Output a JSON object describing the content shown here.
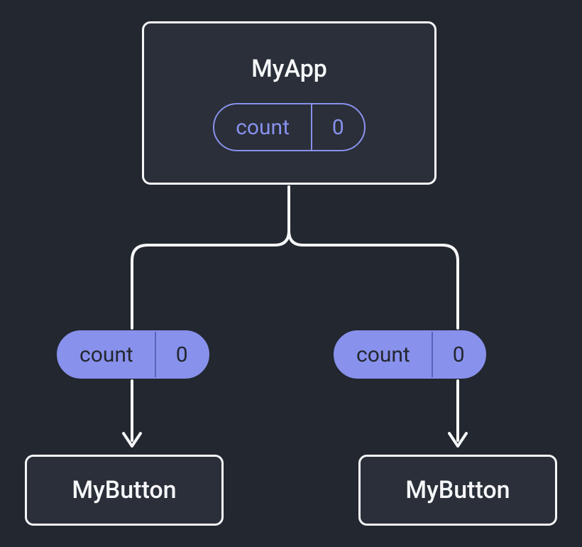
{
  "diagram": {
    "parent": {
      "name": "MyApp",
      "state": {
        "label": "count",
        "value": 0
      }
    },
    "propLeft": {
      "label": "count",
      "value": 0
    },
    "propRight": {
      "label": "count",
      "value": 0
    },
    "childLeft": {
      "name": "MyButton"
    },
    "childRight": {
      "name": "MyButton"
    }
  }
}
